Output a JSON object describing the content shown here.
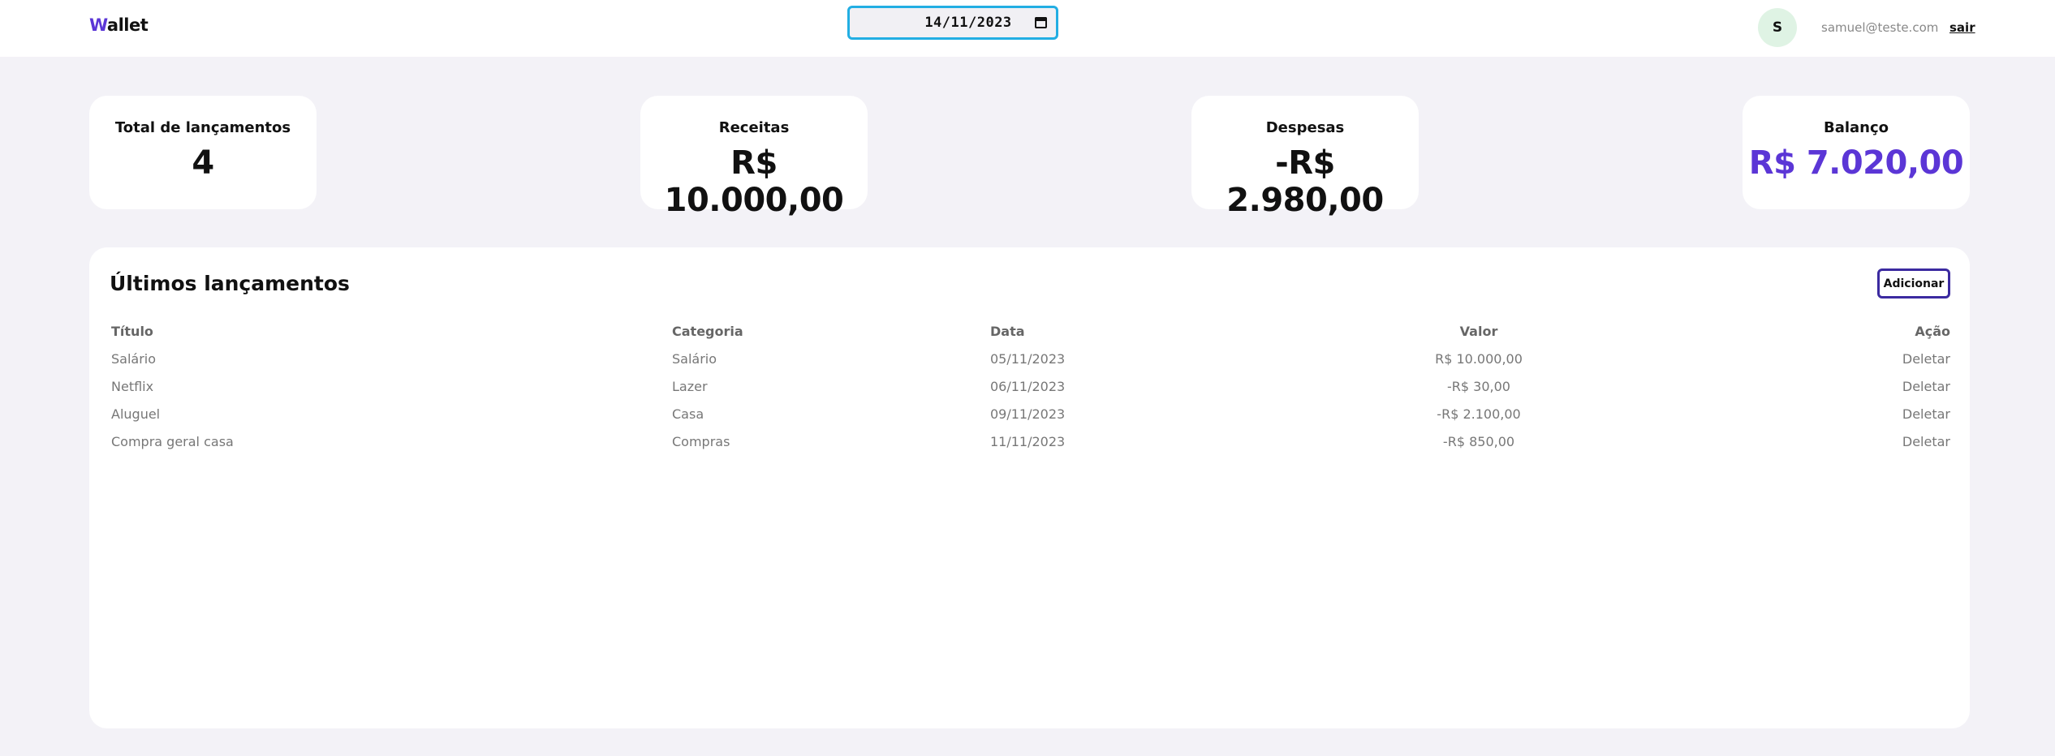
{
  "header": {
    "logo_first": "W",
    "logo_rest": "allet",
    "date_value": "14/11/2023",
    "user_initial": "S",
    "user_email": "samuel@teste.com",
    "logout_label": "sair"
  },
  "summary": {
    "total": {
      "label": "Total de lançamentos",
      "value": "4"
    },
    "income": {
      "label": "Receitas",
      "value": "R$ 10.000,00"
    },
    "expenses": {
      "label": "Despesas",
      "value": "-R$ 2.980,00"
    },
    "balance": {
      "label": "Balanço",
      "value": "R$ 7.020,00"
    }
  },
  "entries": {
    "title": "Últimos lançamentos",
    "add_label": "Adicionar",
    "columns": {
      "title": "Título",
      "category": "Categoria",
      "date": "Data",
      "value": "Valor",
      "action": "Ação"
    },
    "rows": [
      {
        "title": "Salário",
        "category": "Salário",
        "date": "05/11/2023",
        "value": "R$ 10.000,00",
        "action": "Deletar"
      },
      {
        "title": "Netflix",
        "category": "Lazer",
        "date": "06/11/2023",
        "value": "-R$ 30,00",
        "action": "Deletar"
      },
      {
        "title": "Aluguel",
        "category": "Casa",
        "date": "09/11/2023",
        "value": "-R$ 2.100,00",
        "action": "Deletar"
      },
      {
        "title": "Compra geral casa",
        "category": "Compras",
        "date": "11/11/2023",
        "value": "-R$ 850,00",
        "action": "Deletar"
      }
    ]
  },
  "colors": {
    "accent": "#5b36d6",
    "date_border": "#22aee3",
    "avatar_bg": "#dff3e4",
    "page_bg": "#f3f2f7"
  }
}
